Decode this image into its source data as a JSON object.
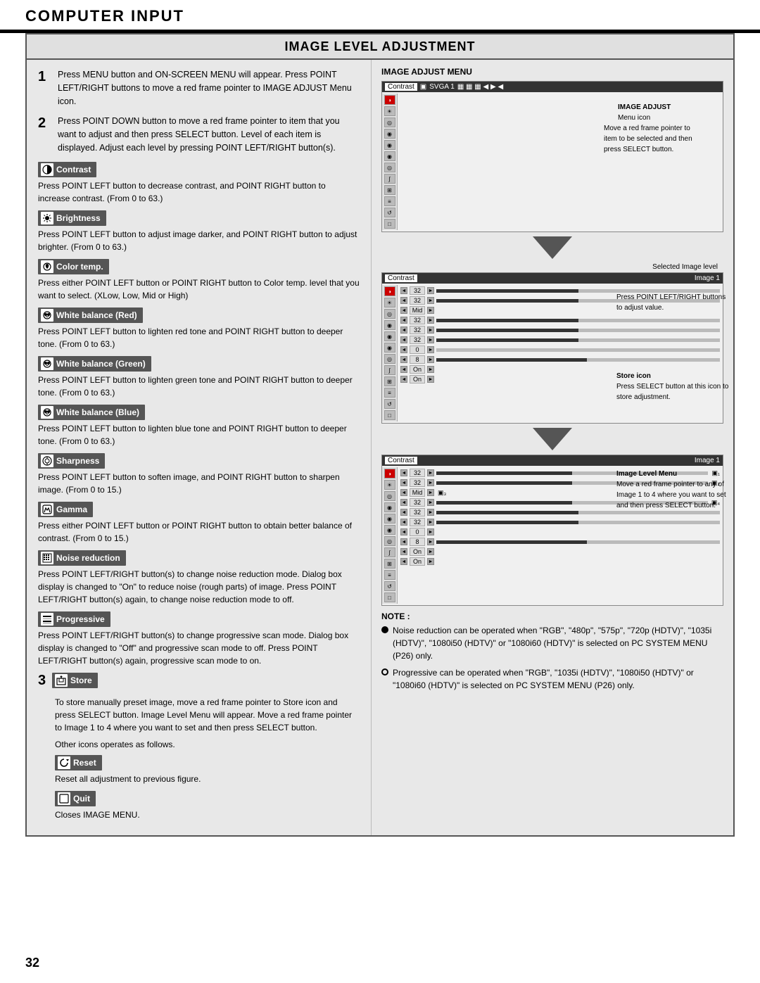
{
  "header": {
    "title": "COMPUTER INPUT"
  },
  "page_number": "32",
  "section": {
    "title": "IMAGE LEVEL ADJUSTMENT"
  },
  "steps": {
    "step1": "Press MENU button and ON-SCREEN MENU will appear.  Press POINT LEFT/RIGHT buttons to move a red frame pointer to IMAGE ADJUST Menu icon.",
    "step2": "Press POINT DOWN button to move a red frame pointer to item that you want to adjust and then press SELECT button. Level of each item is displayed.  Adjust each level by pressing POINT LEFT/RIGHT button(s).",
    "step3_text": "To store manually preset image, move a red frame pointer to Store icon and press SELECT button.  Image Level Menu will appear.  Move a red frame pointer to Image 1 to 4 where you want to set and then press SELECT button.",
    "step3_other": "Other icons operates as follows."
  },
  "items": [
    {
      "id": "contrast",
      "label": "Contrast",
      "desc": "Press POINT LEFT button to decrease contrast, and POINT RIGHT button to increase contrast.  (From 0 to 63.)"
    },
    {
      "id": "brightness",
      "label": "Brightness",
      "desc": "Press POINT LEFT button to adjust image darker, and POINT RIGHT button to adjust brighter.  (From 0 to 63.)"
    },
    {
      "id": "color-temp",
      "label": "Color temp.",
      "desc": "Press either POINT LEFT button or POINT RIGHT button to Color temp. level that you want to select. (XLow, Low, Mid or High)"
    },
    {
      "id": "white-balance-red",
      "label": "White balance (Red)",
      "desc": "Press POINT LEFT button to lighten red tone and POINT RIGHT button to deeper tone.  (From 0 to 63.)"
    },
    {
      "id": "white-balance-green",
      "label": "White balance (Green)",
      "desc": "Press POINT LEFT button to lighten green tone and POINT RIGHT button to deeper tone.  (From 0 to 63.)"
    },
    {
      "id": "white-balance-blue",
      "label": "White balance (Blue)",
      "desc": "Press POINT LEFT button to lighten blue tone and POINT RIGHT button to deeper tone.  (From 0 to 63.)"
    },
    {
      "id": "sharpness",
      "label": "Sharpness",
      "desc": "Press POINT LEFT button to soften image, and POINT RIGHT button to sharpen image.  (From 0 to 15.)"
    },
    {
      "id": "gamma",
      "label": "Gamma",
      "desc": "Press either POINT LEFT button or POINT RIGHT button to obtain better balance of contrast.  (From 0 to 15.)"
    },
    {
      "id": "noise-reduction",
      "label": "Noise reduction",
      "desc": "Press POINT LEFT/RIGHT button(s) to change noise reduction mode.  Dialog box display is changed to \"On\" to reduce noise (rough parts)  of  image.  Press POINT LEFT/RIGHT button(s) again, to change noise reduction mode to off."
    },
    {
      "id": "progressive",
      "label": "Progressive",
      "desc": "Press POINT LEFT/RIGHT button(s) to change progressive scan mode. Dialog box display is changed to \"Off\" and progressive scan mode to off. Press POINT LEFT/RIGHT button(s) again, progressive scan mode to on."
    }
  ],
  "store": {
    "label": "Store",
    "desc": ""
  },
  "reset": {
    "label": "Reset",
    "desc": "Reset all adjustment to previous figure."
  },
  "quit": {
    "label": "Quit",
    "desc": "Closes IMAGE MENU."
  },
  "right_column": {
    "menu_title": "IMAGE ADJUST MENU",
    "menu_tab": "Contrast",
    "menu_tab2": "SVGA 1",
    "image_adjust_label": "IMAGE ADJUST",
    "menu_icon_label": "Menu icon",
    "pointer_label": "Move a red frame pointer to\nitem to be selected and then\npress SELECT button.",
    "selected_image_label": "Selected Image level",
    "adjust_label": "Press POINT LEFT/RIGHT buttons\nto adjust value.",
    "store_label": "Store icon",
    "store_desc": "Press SELECT button at this icon to\nstore adjustment.",
    "image_level_menu_label": "Image Level Menu",
    "image_level_desc": "Move a red frame pointer to any\nof Image 1 to 4 where you want\nto set  and then press SELECT\nbutton.",
    "menu_rows": [
      {
        "val": "32",
        "fill": 50
      },
      {
        "val": "32",
        "fill": 50
      },
      {
        "val": "Mid",
        "fill": 0,
        "text": true
      },
      {
        "val": "32",
        "fill": 50
      },
      {
        "val": "32",
        "fill": 50
      },
      {
        "val": "32",
        "fill": 50
      },
      {
        "val": "0",
        "fill": 0
      },
      {
        "val": "8",
        "fill": 53
      },
      {
        "val": "On",
        "fill": 0,
        "text": true
      },
      {
        "val": "On",
        "fill": 0,
        "text": true
      }
    ]
  },
  "notes": [
    "Noise reduction can be operated when  \"RGB\", \"480p\", \"575p\", \"720p (HDTV)\", \"1035i (HDTV)\", \"1080i50 (HDTV)\" or \"1080i60 (HDTV)\" is selected on PC SYSTEM MENU (P26) only.",
    "Progressive can be operated when  \"RGB\", \"1035i (HDTV)\", \"1080i50 (HDTV)\" or \"1080i60 (HDTV)\" is selected on PC SYSTEM MENU (P26) only."
  ]
}
